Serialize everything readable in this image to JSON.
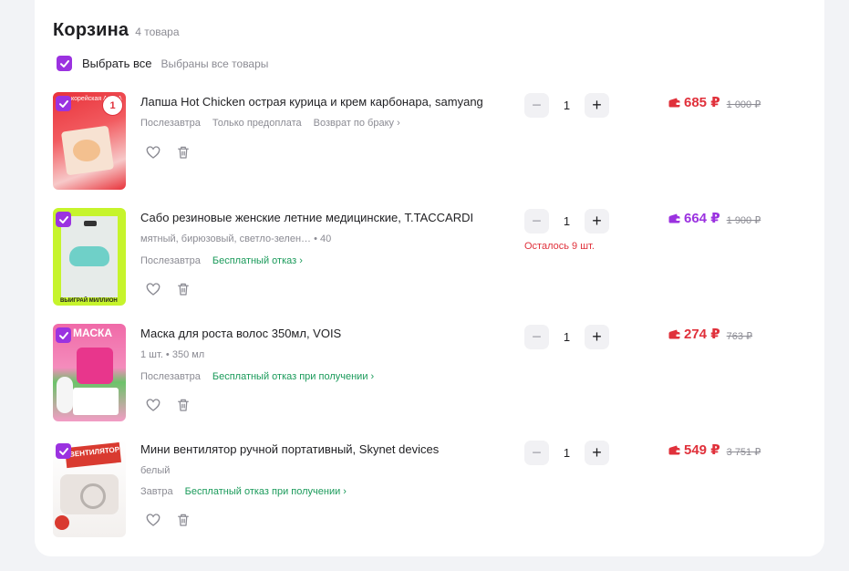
{
  "cart": {
    "title": "Корзина",
    "count": "4 товара",
    "select_all_label": "Выбрать все",
    "select_all_note": "Выбраны все товары"
  },
  "colors": {
    "accent": "#9b32e0",
    "price_red": "#e0313b",
    "green": "#1a9a5a"
  },
  "items": [
    {
      "name": "Лапша Hot Chicken острая курица и крем карбонара, samyang",
      "meta": [
        "Послезавтра",
        "Только предоплата",
        "Возврат по браку ›"
      ],
      "thumb_text": "корейская АПША",
      "thumb_badge": "1",
      "qty": "1",
      "price": "685 ₽",
      "old_price": "1 000 ₽",
      "price_color": "red"
    },
    {
      "name": "Сабо резиновые женские летние медицинские, T.TACCARDI",
      "variant": "мятный, бирюзовый, светло-зелен…  • 40",
      "meta": [
        "Послезавтра",
        "Бесплатный отказ ›"
      ],
      "thumb_text": "ВЫИГРАЙ МИЛЛИОН",
      "qty": "1",
      "stock_note": "Осталось 9 шт.",
      "price": "664 ₽",
      "old_price": "1 900 ₽",
      "price_color": "violet"
    },
    {
      "name": "Маска для роста волос 350мл, VOIS",
      "variant": "1 шт. • 350 мл",
      "meta": [
        "Послезавтра",
        "Бесплатный отказ при получении ›"
      ],
      "thumb_text": "МАСКА",
      "qty": "1",
      "price": "274 ₽",
      "old_price": "763 ₽",
      "price_color": "red"
    },
    {
      "name": "Мини вентилятор ручной портативный, Skynet devices",
      "variant": "белый",
      "meta": [
        "Завтра",
        "Бесплатный отказ при получении ›"
      ],
      "thumb_text": "ВЕНТИЛЯТОР",
      "qty": "1",
      "price": "549 ₽",
      "old_price": "3 751 ₽",
      "price_color": "red"
    }
  ]
}
